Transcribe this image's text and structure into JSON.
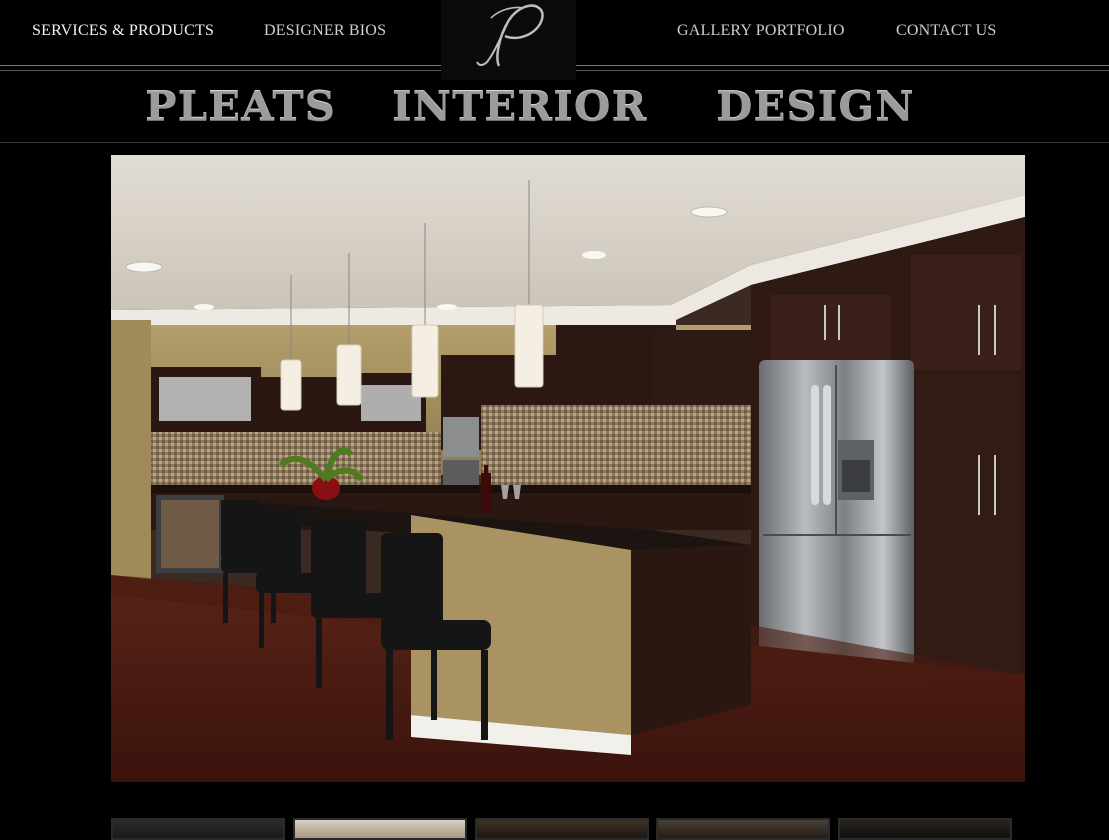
{
  "nav": {
    "items": [
      {
        "label": "SERVICES & PRODUCTS",
        "active": true
      },
      {
        "label": "DESIGNER BIOS",
        "active": false
      },
      {
        "label": "GALLERY PORTFOLIO",
        "active": false
      },
      {
        "label": "CONTACT US",
        "active": false
      }
    ],
    "logo_letter": "P"
  },
  "brand": {
    "words": [
      "PLEATS",
      "INTERIOR",
      "DESIGN"
    ]
  },
  "hero": {
    "icon": "kitchen-photo"
  },
  "thumbnails": {
    "count": 5
  },
  "colors": {
    "background": "#000000",
    "nav_text": "#cfcfcf",
    "brand_text": "#9b9b9b",
    "rule": "#7a7a7a"
  }
}
